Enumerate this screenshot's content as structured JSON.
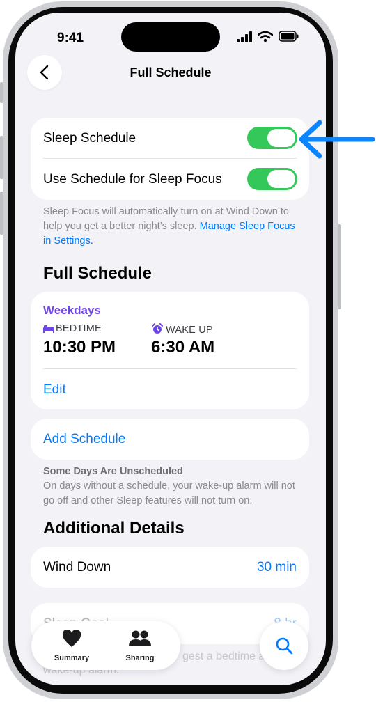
{
  "status_bar": {
    "time": "9:41"
  },
  "nav": {
    "title": "Full Schedule",
    "back_icon": "chevron-left-icon"
  },
  "sleep_settings": {
    "sleep_schedule_label": "Sleep Schedule",
    "sleep_schedule_on": true,
    "sleep_focus_label": "Use Schedule for Sleep Focus",
    "sleep_focus_on": true,
    "footnote_text": "Sleep Focus will automatically turn on at Wind Down to help you get a better night’s sleep.",
    "footnote_link": "Manage Sleep Focus in Settings."
  },
  "full_schedule": {
    "heading": "Full Schedule",
    "schedule": {
      "days": "Weekdays",
      "bedtime_label": "BEDTIME",
      "bedtime_value": "10:30 PM",
      "wakeup_label": "WAKE UP",
      "wakeup_value": "6:30 AM",
      "edit_label": "Edit"
    },
    "add_schedule_label": "Add Schedule",
    "unscheduled_title": "Some Days Are Unscheduled",
    "unscheduled_text": "On days without a schedule, your wake-up alarm will not go off and other Sleep features will not turn on."
  },
  "additional_details": {
    "heading": "Additional Details",
    "wind_down_label": "Wind Down",
    "wind_down_value": "30 min",
    "partial_row_label": "Sleep Goal",
    "partial_row_value": "8 hr",
    "partial_text_1": "gest a bedtime a",
    "partial_text_2": "wake-up alarm."
  },
  "tab_bar": {
    "tabs": [
      {
        "label": "Summary",
        "icon": "heart-icon"
      },
      {
        "label": "Sharing",
        "icon": "people-icon"
      }
    ],
    "search_icon": "search-icon"
  },
  "colors": {
    "accent": "#007aff",
    "toggle_on": "#34c759",
    "weekday_purple": "#6f46e8",
    "callout_arrow": "#0a84ff",
    "background": "#f2f2f7"
  }
}
